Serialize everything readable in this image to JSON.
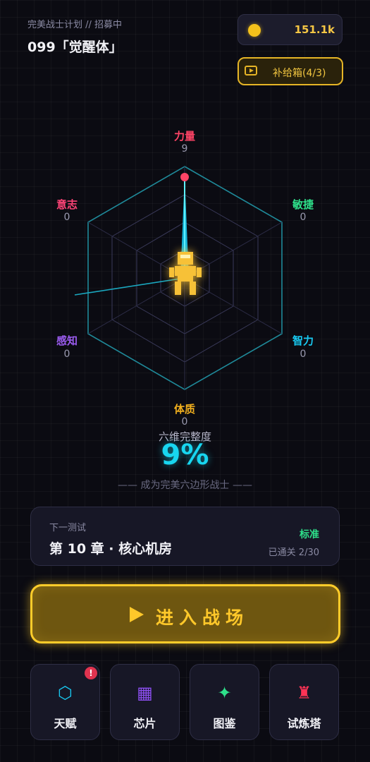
{
  "header": {
    "subtitle": "完美战士计划 // 招募中",
    "title": "099「觉醒体」"
  },
  "currency": {
    "icon": "coin-icon",
    "value": "151.1k"
  },
  "supply_box": {
    "icon": "video-play-icon",
    "label": "补给箱(4/3)"
  },
  "stats": [
    {
      "name": "力量",
      "value": "9",
      "color": "#ff4466"
    },
    {
      "name": "敏捷",
      "value": "0",
      "color": "#2ee08a"
    },
    {
      "name": "智力",
      "value": "0",
      "color": "#18c8f0"
    },
    {
      "name": "体质",
      "value": "0",
      "color": "#f2b01e"
    },
    {
      "name": "感知",
      "value": "0",
      "color": "#9b5cf0"
    },
    {
      "name": "意志",
      "value": "0",
      "color": "#ff4477"
    }
  ],
  "completeness": {
    "label": "六维完整度",
    "value": "9%"
  },
  "motto": "—— 成为完美六边形战士 ——",
  "next_test": {
    "label": "下一测试",
    "chapter": "第 10 章 · 核心机房",
    "difficulty": "标准",
    "progress": "已通关 2/30"
  },
  "battle_button": {
    "label": "进入战场",
    "icon": "play-icon"
  },
  "nav": [
    {
      "label": "天赋",
      "icon": "hexagon-icon",
      "glyph": "⬡",
      "color": "#18c8f0",
      "badge": "!"
    },
    {
      "label": "芯片",
      "icon": "chip-icon",
      "glyph": "▦",
      "color": "#8c4ff0"
    },
    {
      "label": "图鉴",
      "icon": "sparkle-icon",
      "glyph": "✦",
      "color": "#2ee08a"
    },
    {
      "label": "试炼塔",
      "icon": "tower-icon",
      "glyph": "♜",
      "color": "#ff3355"
    }
  ],
  "colors": {
    "accent_gold": "#ffc82a",
    "accent_cyan": "#18d6f0",
    "background": "#0b0b12"
  }
}
